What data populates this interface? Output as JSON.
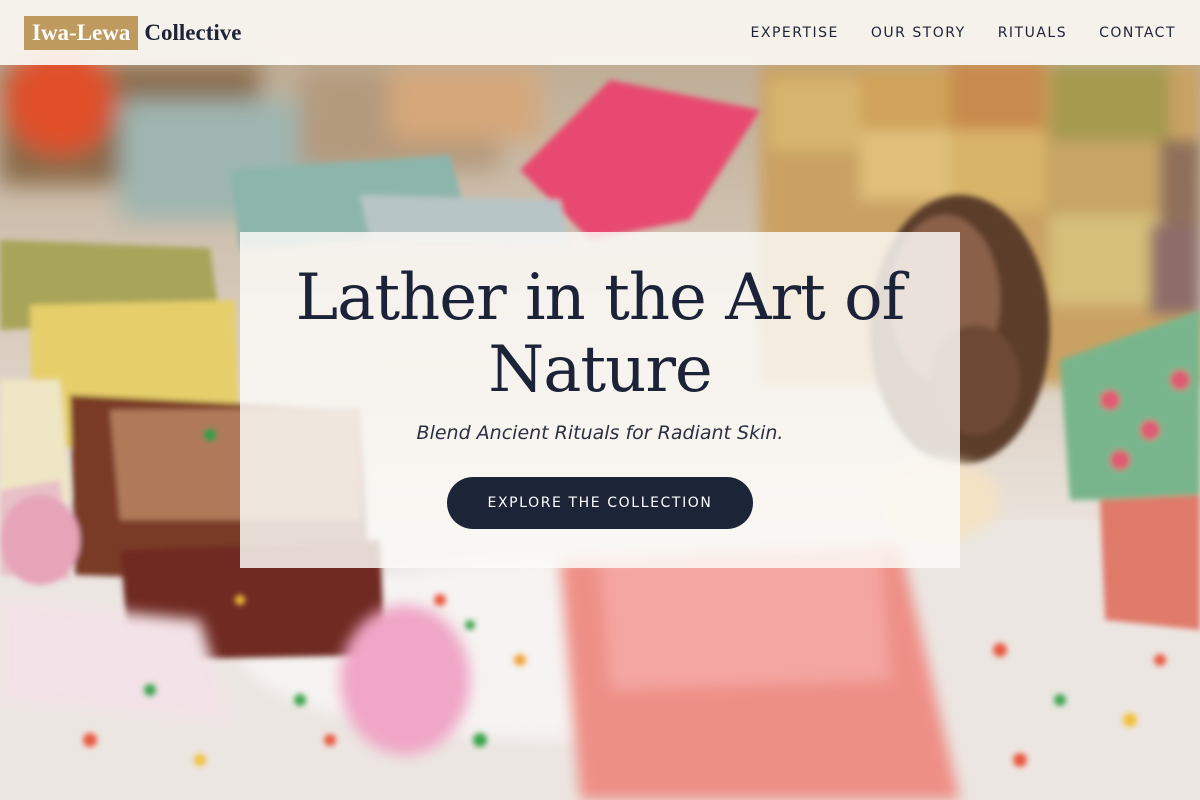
{
  "brand": {
    "mark": "Iwa-Lewa",
    "name": "Collective",
    "accent_color": "#bf9a5e",
    "text_color": "#1e2436"
  },
  "nav": {
    "items": [
      {
        "label": "EXPERTISE"
      },
      {
        "label": "OUR STORY"
      },
      {
        "label": "RITUALS"
      },
      {
        "label": "CONTACT"
      }
    ]
  },
  "hero": {
    "title": "Lather in the Art of Nature",
    "subtitle": "Blend Ancient Rituals for Radiant Skin.",
    "cta_label": "EXPLORE THE COLLECTION",
    "cta_color": "#1c2438",
    "background_image": "blurred-handmade-soaps-photo"
  }
}
